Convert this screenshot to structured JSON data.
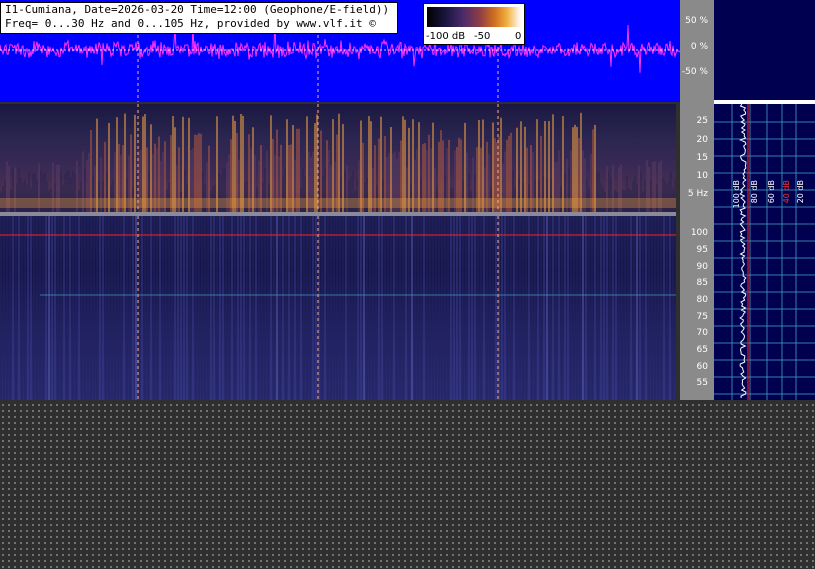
{
  "header": {
    "line1": "I1-Cumiana, Date=2026-03-20 Time=12:00 (Geophone/E-field))",
    "line2": "Freq= 0...30 Hz and 0...105 Hz, provided by www.vlf.it ©"
  },
  "color_scale": {
    "labels": [
      "-100 dB",
      "-50",
      "0"
    ]
  },
  "amplitude_axis": {
    "ticks": [
      "50 %",
      "0 %",
      "-50 %"
    ]
  },
  "freq_axis_low": {
    "ticks": [
      "25",
      "20",
      "15",
      "10",
      "5 Hz"
    ]
  },
  "freq_axis_high": {
    "ticks": [
      "100",
      "95",
      "90",
      "85",
      "80",
      "75",
      "70",
      "65",
      "60",
      "55"
    ]
  },
  "level_labels": [
    "100 dB",
    "80 dB",
    "60 dB",
    "40 dB",
    "20 dB"
  ],
  "colors": {
    "waveform": "#ff33ff",
    "background_blue": "#0000ff",
    "marker_red": "#ff2020",
    "grid_cyan": "#3fa0c0"
  }
}
